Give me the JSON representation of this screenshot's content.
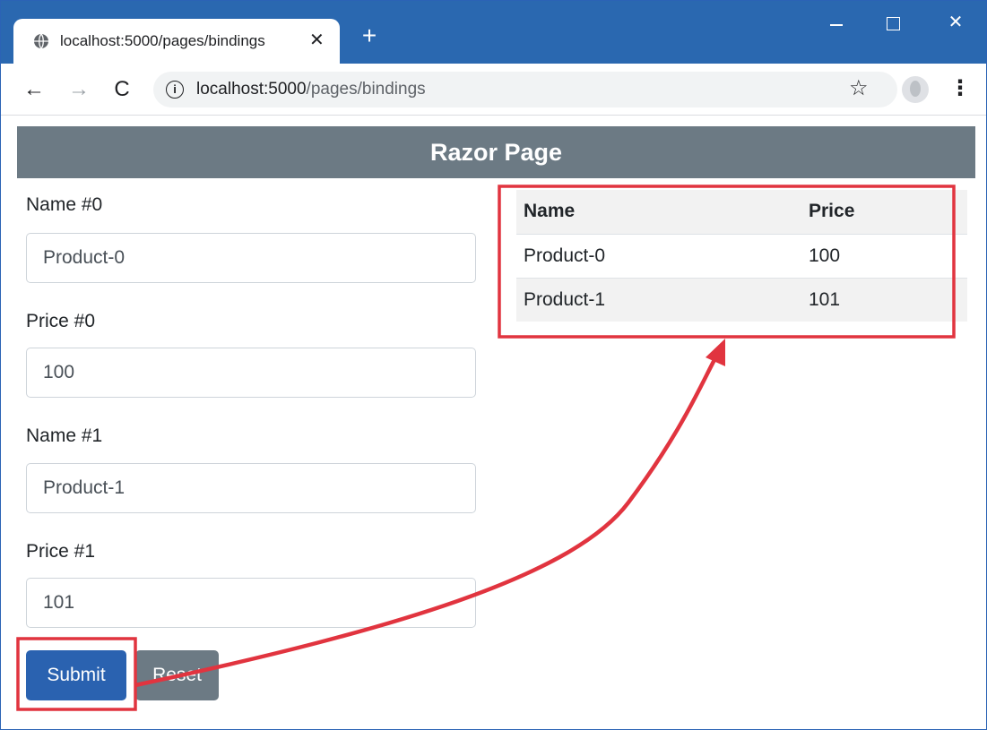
{
  "browser": {
    "tab_title": "localhost:5000/pages/bindings",
    "tab_close": "✕",
    "new_tab": "+",
    "url_host": "localhost:5000",
    "url_path": "/pages/bindings",
    "minimize": "",
    "maximize": "",
    "close": "✕"
  },
  "page": {
    "header": "Razor Page",
    "fields": [
      {
        "label": "Name #0",
        "value": "Product-0"
      },
      {
        "label": "Price #0",
        "value": "100"
      },
      {
        "label": "Name #1",
        "value": "Product-1"
      },
      {
        "label": "Price #1",
        "value": "101"
      }
    ],
    "submit_label": "Submit",
    "reset_label": "Reset",
    "table": {
      "headers": [
        "Name",
        "Price"
      ],
      "rows": [
        [
          "Product-0",
          "100"
        ],
        [
          "Product-1",
          "101"
        ]
      ]
    }
  },
  "colors": {
    "titlebar": "#2a68b0",
    "header": "#6c7a84",
    "submit": "#2a62b0",
    "reset": "#6c7a84",
    "annotation": "#e1343f"
  }
}
